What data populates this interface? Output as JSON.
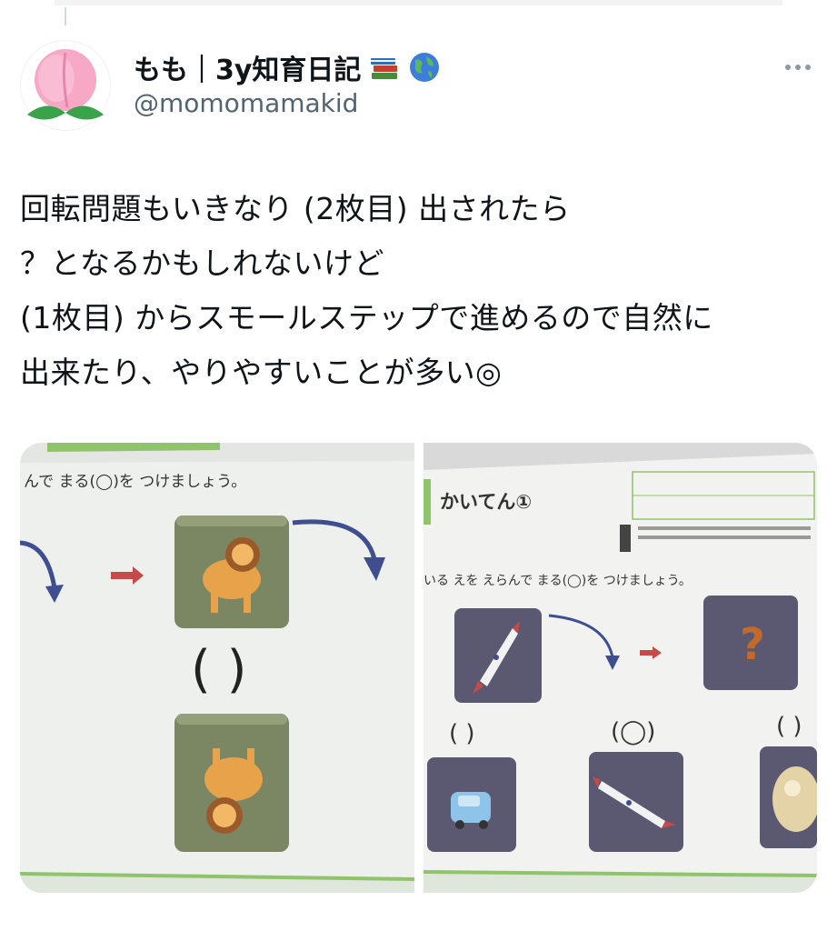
{
  "tweet": {
    "display_name": "もも｜3y知育日記",
    "name_emojis": [
      "books-emoji",
      "globe-emoji"
    ],
    "handle": "@momomamakid",
    "lines": [
      "回転問題もいきなり (2枚目) 出されたら",
      "？となるかもしれないけど",
      "(1枚目) からスモールステップで進めるので自然に",
      "出来たり、やりやすいことが多い◎"
    ]
  },
  "photo1": {
    "instruction": "んで まる(◯)を つけましょう。",
    "paren": "(  )",
    "icon_top": "lion",
    "icon_bottom": "lion-rotated"
  },
  "photo2": {
    "title": "かいてん①",
    "instruction": "いる えを えらんで まる(◯)を つけましょう。",
    "question_mark": "?",
    "choice_labels": [
      "(  )",
      "(◯)",
      "( )"
    ],
    "icons": [
      "rocket",
      "car",
      "rocket-rotated",
      "bear"
    ],
    "accent_colors": {
      "box_purple": "#5b5872",
      "box_green": "#7b8663",
      "arrow_blue": "#3f4e8f",
      "arrow_red": "#c74a4a",
      "question": "#c06a2b",
      "paper_green": "#8fc46a"
    }
  }
}
